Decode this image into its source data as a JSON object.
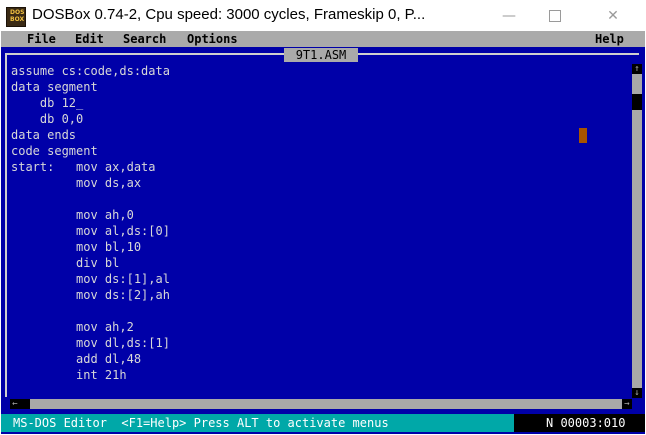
{
  "window": {
    "title": "DOSBox 0.74-2, Cpu speed:     3000 cycles, Frameskip  0, P...",
    "minimize_glyph": "—",
    "close_glyph": "✕",
    "icon": "dosbox-icon",
    "icon_text_top": "DOS",
    "icon_text_bottom": "BOX"
  },
  "menubar": {
    "file": "File",
    "edit": "Edit",
    "search": "Search",
    "options": "Options",
    "help": "Help"
  },
  "editor": {
    "doc_title": "9T1.ASM",
    "lines": [
      "assume cs:code,ds:data",
      "data segment",
      "    db 12_",
      "    db 0,0",
      "data ends",
      "code segment",
      "start:   mov ax,data",
      "         mov ds,ax",
      "",
      "         mov ah,0",
      "         mov al,ds:[0]",
      "         mov bl,10",
      "         div bl",
      "         mov ds:[1],al",
      "         mov ds:[2],ah",
      "",
      "         mov ah,2",
      "         mov dl,ds:[1]",
      "         add dl,48",
      "         int 21h"
    ],
    "scroll_up_glyph": "↑",
    "scroll_down_glyph": "↓",
    "scroll_left_glyph": "←",
    "scroll_right_glyph": "→"
  },
  "statusbar": {
    "text": "MS-DOS Editor  <F1=Help> Press ALT to activate menus",
    "position": "N 00003:010"
  },
  "colors": {
    "dos_background": "#0000a8",
    "menu_background": "#aaaaaa",
    "status_background": "#00a8a8",
    "cursor": "#a85400"
  }
}
